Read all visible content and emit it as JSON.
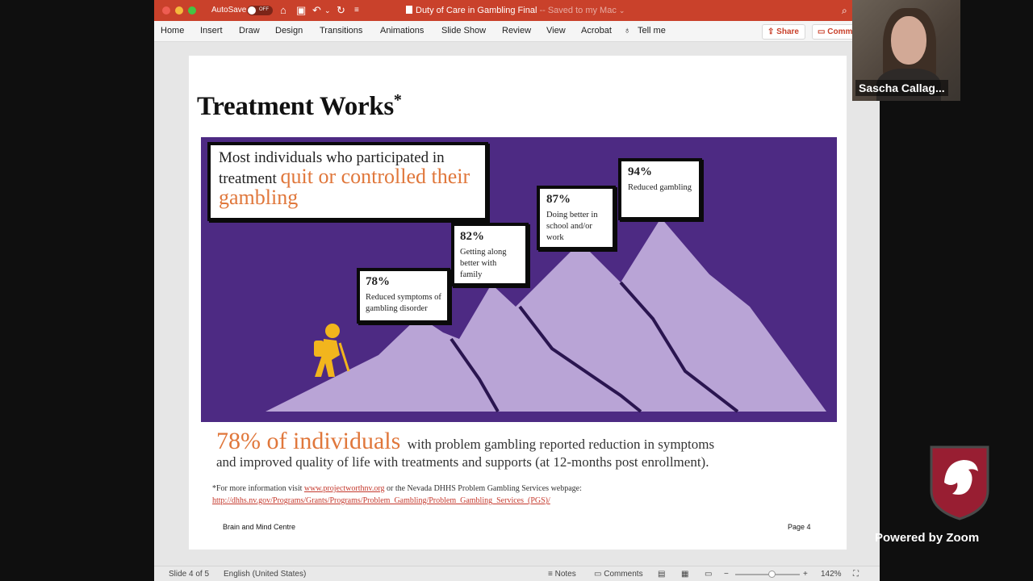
{
  "titlebar": {
    "autosave_label": "AutoSave",
    "autosave_state": "OFF",
    "doc_name": "Duty of Care in Gambling Final",
    "doc_saved": " -- Saved to my Mac",
    "colors": {
      "titlebar": "#c9412b"
    }
  },
  "ribbon": {
    "tabs": [
      "Home",
      "Insert",
      "Draw",
      "Design",
      "Transitions",
      "Animations",
      "Slide Show",
      "Review",
      "View",
      "Acrobat",
      "Tell me"
    ],
    "share": "Share",
    "comments": "Comm"
  },
  "slide": {
    "title": "Treatment Works",
    "title_mark": "*",
    "headline_plain": "Most individuals who participated in treatment ",
    "headline_emph": "quit or controlled their gambling",
    "stats": [
      {
        "pct": "78%",
        "desc": "Reduced symptoms of gambling disorder"
      },
      {
        "pct": "82%",
        "desc": "Getting along better with family"
      },
      {
        "pct": "87%",
        "desc": "Doing better in school and/or work"
      },
      {
        "pct": "94%",
        "desc": "Reduced gambling"
      }
    ],
    "big_stat": "78% of individuals",
    "big_rest": "with problem gambling reported reduction in symptoms",
    "big_line2": "and improved quality of life with treatments and supports (at 12-months post enrollment).",
    "footnote_a": "*For more information visit ",
    "footnote_link1": "www.projectworthnv.org",
    "footnote_b": " or the Nevada DHHS Problem Gambling Services webpage:",
    "footnote_link2": "http://dhhs.nv.gov/Programs/Grants/Programs/Problem_Gambling/Problem_Gambling_Services_(PGS)/",
    "footer_left": "Brain and Mind Centre",
    "footer_right": "Page 4",
    "colors": {
      "purple": "#4d2a83",
      "mountain": "#b9a4d6",
      "orange": "#e0773b",
      "hiker": "#f2b51d"
    }
  },
  "statusbar": {
    "slide_info": "Slide 4 of 5",
    "language": "English (United States)",
    "notes": "Notes",
    "comments": "Comments",
    "zoom": "142%"
  },
  "zoom_overlay": {
    "participant": "Sascha Callag...",
    "powered": "Powered by Zoom"
  }
}
